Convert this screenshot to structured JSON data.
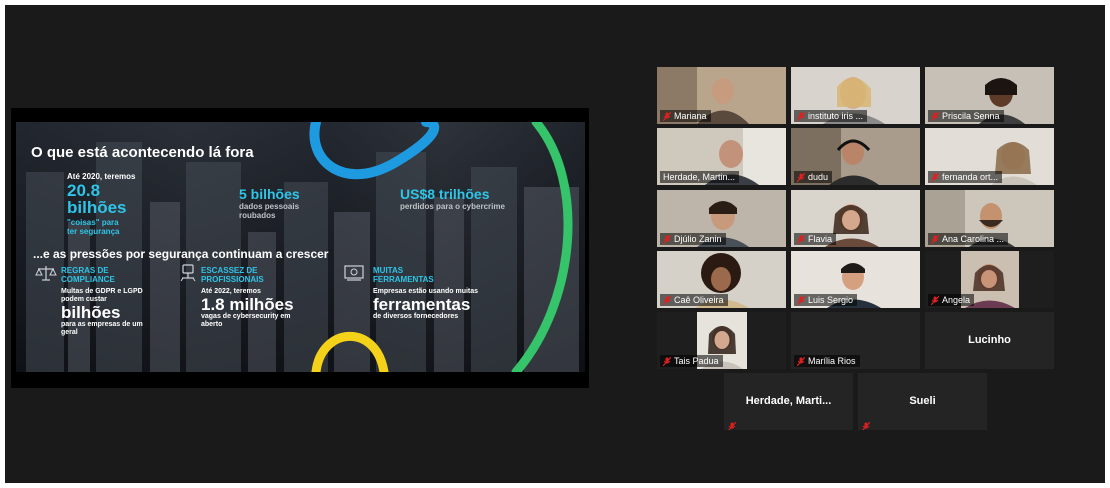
{
  "slide": {
    "title": "O que está acontecendo lá fora",
    "stat1_pre": "Até 2020, teremos",
    "stat1_num": "20.8",
    "stat1_word": "bilhões",
    "stat1_sub1": "\"coisas\" para",
    "stat1_sub2": "ter segurança",
    "stat2_big": "5 bilhões",
    "stat2_sub1": "dados pessoais",
    "stat2_sub2": "roubados",
    "stat3_big": "US$8 trilhões",
    "stat3_sub1": "perdidos para o cybercrime",
    "subtitle": "...e as pressões por segurança continuam a crescer",
    "col1_head1": "REGRAS DE",
    "col1_head2": "COMPLIANCE",
    "col1_b1": "Multas de GDPR e LGPD",
    "col1_b2": "podem custar",
    "col1_big": "bilhões",
    "col1_b3": "para as empresas  de um",
    "col1_b4": "geral",
    "col2_head1": "ESCASSEZ DE",
    "col2_head2": "PROFISSIONAIS",
    "col2_b1": "Até 2022, teremos",
    "col2_big": "1.8 milhões",
    "col2_b2": "vagas de cybersecurity em",
    "col2_b3": "aberto",
    "col3_head1": "MUITAS",
    "col3_head2": "FERRAMENTAS",
    "col3_b1": "Empresas estão usando muitas",
    "col3_big": "ferramentas",
    "col3_b2": "de diversos fornecedores"
  },
  "participants": [
    {
      "name": "Mariana",
      "video": true
    },
    {
      "name": "instituto iris ...",
      "video": true
    },
    {
      "name": "Priscila Senna",
      "video": true
    },
    {
      "name": "Herdade, Martin...",
      "video": true,
      "active": true
    },
    {
      "name": "dudu",
      "video": true
    },
    {
      "name": "fernanda ort...",
      "video": true
    },
    {
      "name": "Djúlio Zanin",
      "video": true
    },
    {
      "name": "Flavia",
      "video": true
    },
    {
      "name": "Ana Carolina ...",
      "video": true
    },
    {
      "name": "Caê Oliveira",
      "video": true
    },
    {
      "name": "Luis Sergio",
      "video": true
    },
    {
      "name": "Angela",
      "video": true
    },
    {
      "name": "Tais Padua",
      "video": true
    },
    {
      "name": "Marília Rios",
      "video": false
    },
    {
      "name": "Lucinho",
      "video": false
    },
    {
      "name": "Herdade,  Marti...",
      "video": false
    },
    {
      "name": "Sueli",
      "video": false
    }
  ],
  "colors": {
    "accent_cyan": "#2ec5e8",
    "active_speaker": "#b5e33a",
    "muted_red": "#e02020",
    "swoosh_blue": "#1e9be0",
    "swoosh_green": "#35c46a",
    "swoosh_yellow": "#f4d21a"
  }
}
